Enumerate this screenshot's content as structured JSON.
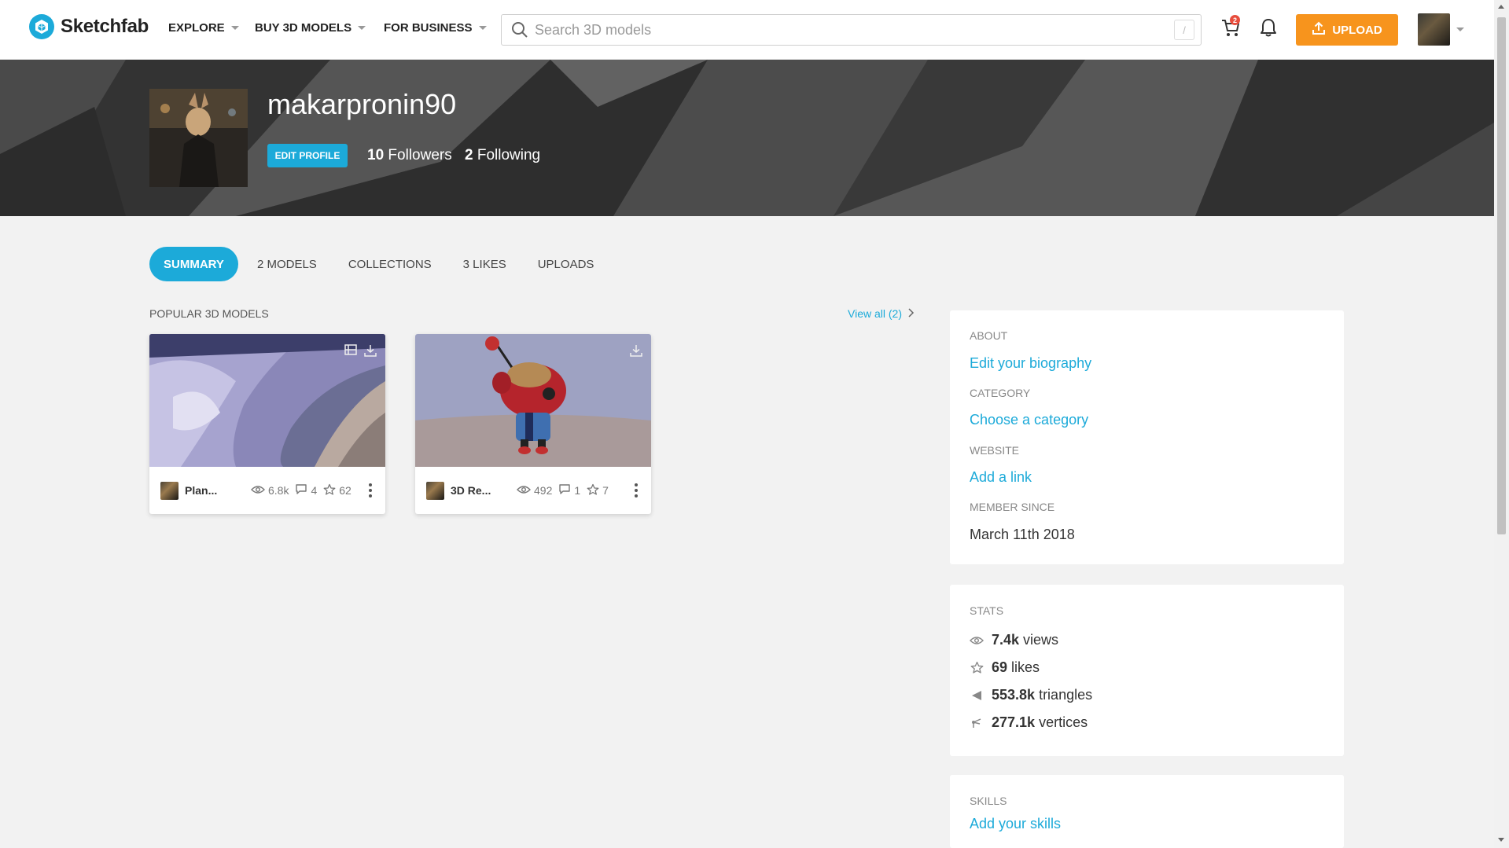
{
  "brand": {
    "name": "Sketchfab",
    "accent": "#1caad9",
    "upload_color": "#f7941d"
  },
  "nav": {
    "items": [
      {
        "label": "EXPLORE"
      },
      {
        "label": "BUY 3D MODELS"
      },
      {
        "label": "FOR BUSINESS"
      }
    ],
    "search_placeholder": "Search 3D models",
    "search_shortcut": "/",
    "cart_badge": "2",
    "upload_label": "UPLOAD"
  },
  "profile": {
    "username": "makarpronin90",
    "edit_label": "EDIT PROFILE",
    "followers_count": "10",
    "followers_label": "Followers",
    "following_count": "2",
    "following_label": "Following"
  },
  "tabs": [
    {
      "label": "SUMMARY",
      "active": true
    },
    {
      "label": "2 MODELS"
    },
    {
      "label": "COLLECTIONS"
    },
    {
      "label": "3 LIKES"
    },
    {
      "label": "UPLOADS"
    }
  ],
  "popular": {
    "title": "POPULAR 3D MODELS",
    "view_all": "View all (2)",
    "models": [
      {
        "name": "Plan...",
        "views": "6.8k",
        "comments": "4",
        "likes": "62"
      },
      {
        "name": "3D Re...",
        "views": "492",
        "comments": "1",
        "likes": "7"
      }
    ]
  },
  "about": {
    "about_label": "ABOUT",
    "biography_link": "Edit your biography",
    "category_label": "CATEGORY",
    "category_link": "Choose a category",
    "website_label": "WEBSITE",
    "website_link": "Add a link",
    "member_since_label": "MEMBER SINCE",
    "member_since": "March 11th 2018"
  },
  "stats": {
    "label": "STATS",
    "views_value": "7.4k",
    "views_label": "views",
    "likes_value": "69",
    "likes_label": "likes",
    "triangles_value": "553.8k",
    "triangles_label": "triangles",
    "vertices_value": "277.1k",
    "vertices_label": "vertices"
  },
  "skills": {
    "label": "SKILLS",
    "link": "Add your skills"
  }
}
